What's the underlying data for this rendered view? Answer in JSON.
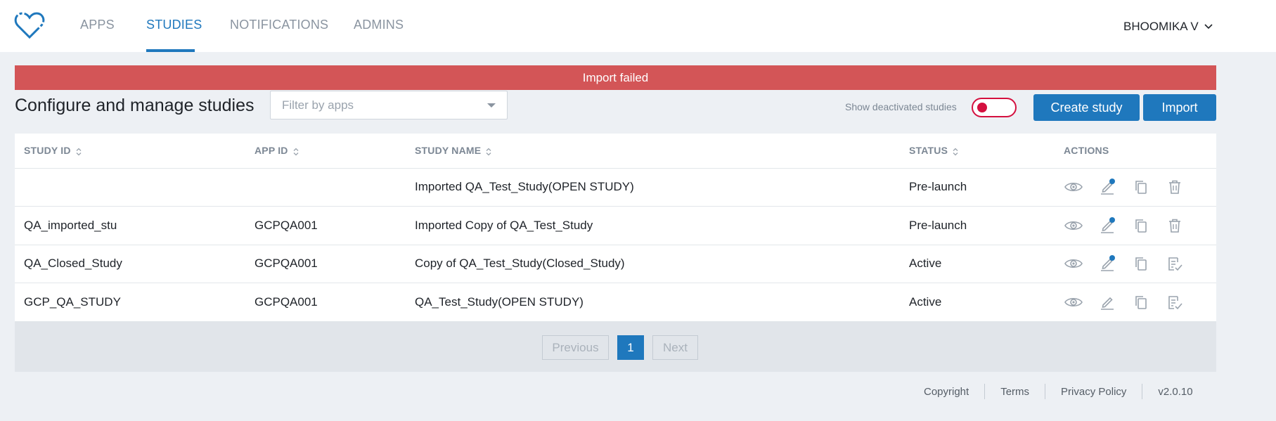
{
  "nav": {
    "items": [
      "APPS",
      "STUDIES",
      "NOTIFICATIONS",
      "ADMINS"
    ],
    "active": "STUDIES",
    "user": "BHOOMIKA V"
  },
  "alert": {
    "message": "Import failed"
  },
  "toolbar": {
    "title": "Configure and manage studies",
    "filter_placeholder": "Filter by apps",
    "toggle_label": "Show deactivated studies",
    "create_label": "Create study",
    "import_label": "Import"
  },
  "table": {
    "headers": [
      "STUDY ID",
      "APP ID",
      "STUDY NAME",
      "STATUS",
      "ACTIONS"
    ],
    "rows": [
      {
        "study_id": "",
        "app_id": "",
        "study_name": "Imported QA_Test_Study(OPEN STUDY)",
        "status": "Pre-launch",
        "edit_badge": true,
        "last_action": "delete"
      },
      {
        "study_id": "QA_imported_stu",
        "app_id": "GCPQA001",
        "study_name": "Imported Copy of QA_Test_Study",
        "status": "Pre-launch",
        "edit_badge": true,
        "last_action": "delete"
      },
      {
        "study_id": "QA_Closed_Study",
        "app_id": "GCPQA001",
        "study_name": "Copy of QA_Test_Study(Closed_Study)",
        "status": "Active",
        "edit_badge": true,
        "last_action": "checklist"
      },
      {
        "study_id": "GCP_QA_STUDY",
        "app_id": "GCPQA001",
        "study_name": "QA_Test_Study(OPEN STUDY)",
        "status": "Active",
        "edit_badge": false,
        "last_action": "checklist"
      }
    ]
  },
  "pagination": {
    "prev_label": "Previous",
    "current": "1",
    "next_label": "Next"
  },
  "footer": {
    "copyright": "Copyright",
    "terms": "Terms",
    "privacy": "Privacy Policy",
    "version": "v2.0.10"
  },
  "colors": {
    "primary": "#1f78bd",
    "alert": "#d35557",
    "toggle": "#d4103f",
    "background": "#edf0f4"
  }
}
